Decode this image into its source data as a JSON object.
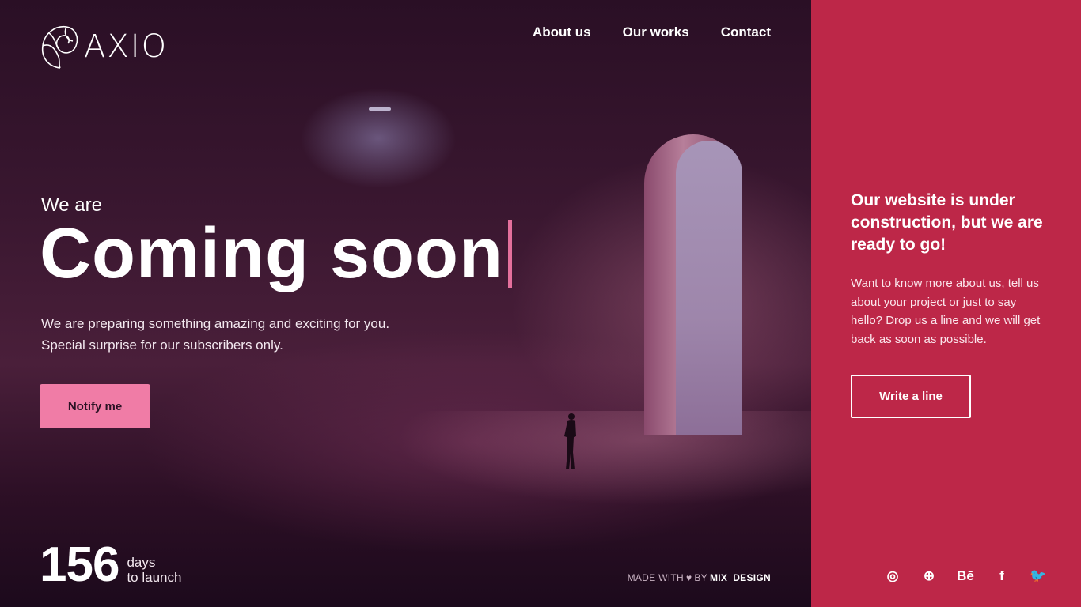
{
  "brand": {
    "name": "AXIO"
  },
  "nav": {
    "about": "About us",
    "works": "Our works",
    "contact": "Contact"
  },
  "hero": {
    "eyebrow": "We are",
    "headline": "Coming soon",
    "description_line1": "We are preparing something amazing and exciting for you.",
    "description_line2": "Special surprise for our subscribers only.",
    "cta_label": "Notify me"
  },
  "countdown": {
    "number": "156",
    "unit": "days",
    "caption": "to launch"
  },
  "credit": {
    "prefix": "MADE WITH",
    "middle": "BY",
    "author": "MIX_DESIGN"
  },
  "panel": {
    "title": "Our website is under construction, but we are ready to go!",
    "body": "Want to know more about us, tell us about your project or just to say hello? Drop us a line and we will get back as soon as possible.",
    "cta_label": "Write a line"
  },
  "social": [
    {
      "name": "instagram-icon",
      "glyph": "◎"
    },
    {
      "name": "dribbble-icon",
      "glyph": "⊕"
    },
    {
      "name": "behance-icon",
      "glyph": "Bē"
    },
    {
      "name": "facebook-icon",
      "glyph": "f"
    },
    {
      "name": "twitter-icon",
      "glyph": "🐦"
    }
  ],
  "colors": {
    "accent_pink": "#f07ca6",
    "panel_red": "#bd2748",
    "cursor": "#e4709c"
  }
}
